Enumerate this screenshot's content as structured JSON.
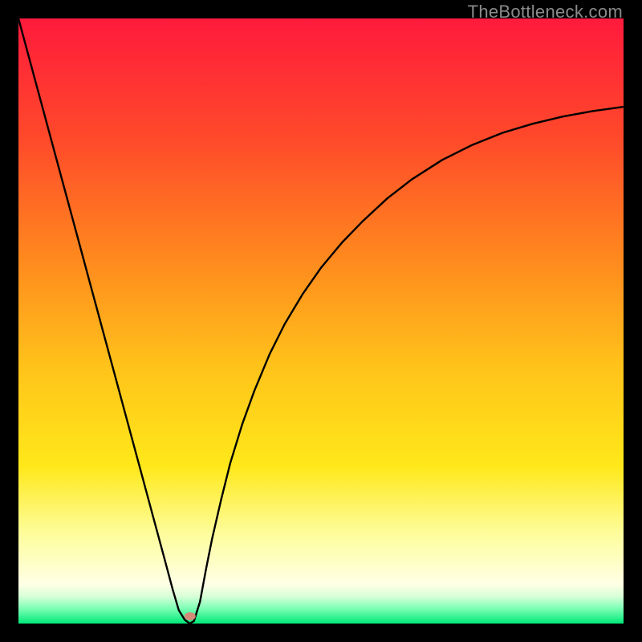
{
  "watermark": "TheBottleneck.com",
  "chart_data": {
    "type": "line",
    "title": "",
    "xlabel": "",
    "ylabel": "",
    "xlim": [
      0,
      100
    ],
    "ylim": [
      0,
      100
    ],
    "gradient_stops": [
      {
        "offset": 0.0,
        "color": "#ff1a3c"
      },
      {
        "offset": 0.2,
        "color": "#ff4a2a"
      },
      {
        "offset": 0.4,
        "color": "#ff8a1e"
      },
      {
        "offset": 0.58,
        "color": "#ffc41a"
      },
      {
        "offset": 0.74,
        "color": "#ffe81a"
      },
      {
        "offset": 0.85,
        "color": "#fdfd9a"
      },
      {
        "offset": 0.935,
        "color": "#ffffe6"
      },
      {
        "offset": 0.955,
        "color": "#d8ffd8"
      },
      {
        "offset": 0.975,
        "color": "#7dffb5"
      },
      {
        "offset": 1.0,
        "color": "#00e878"
      }
    ],
    "series": [
      {
        "name": "bottleneck-curve",
        "x": [
          0.0,
          2.0,
          4.0,
          6.0,
          8.0,
          10.0,
          12.0,
          14.0,
          16.0,
          18.0,
          20.0,
          22.0,
          24.0,
          25.5,
          26.5,
          27.5,
          28.3,
          29.0,
          30.0,
          31.0,
          32.0,
          33.5,
          35.0,
          37.0,
          39.0,
          41.5,
          44.0,
          47.0,
          50.0,
          53.5,
          57.0,
          61.0,
          65.0,
          70.0,
          75.0,
          80.0,
          85.0,
          90.0,
          95.0,
          100.0
        ],
        "y": [
          100.0,
          92.6,
          85.2,
          77.8,
          70.4,
          63.0,
          55.6,
          48.2,
          40.8,
          33.4,
          26.0,
          18.6,
          11.2,
          5.6,
          2.2,
          0.6,
          0.0,
          0.4,
          3.6,
          9.0,
          14.0,
          20.5,
          26.5,
          33.0,
          38.5,
          44.5,
          49.5,
          54.5,
          58.8,
          63.0,
          66.6,
          70.3,
          73.4,
          76.6,
          79.1,
          81.1,
          82.6,
          83.8,
          84.7,
          85.4
        ]
      }
    ],
    "marker": {
      "x": 28.35,
      "y": 1.2,
      "rx": 7,
      "ry": 5,
      "color": "#d48c78"
    }
  }
}
